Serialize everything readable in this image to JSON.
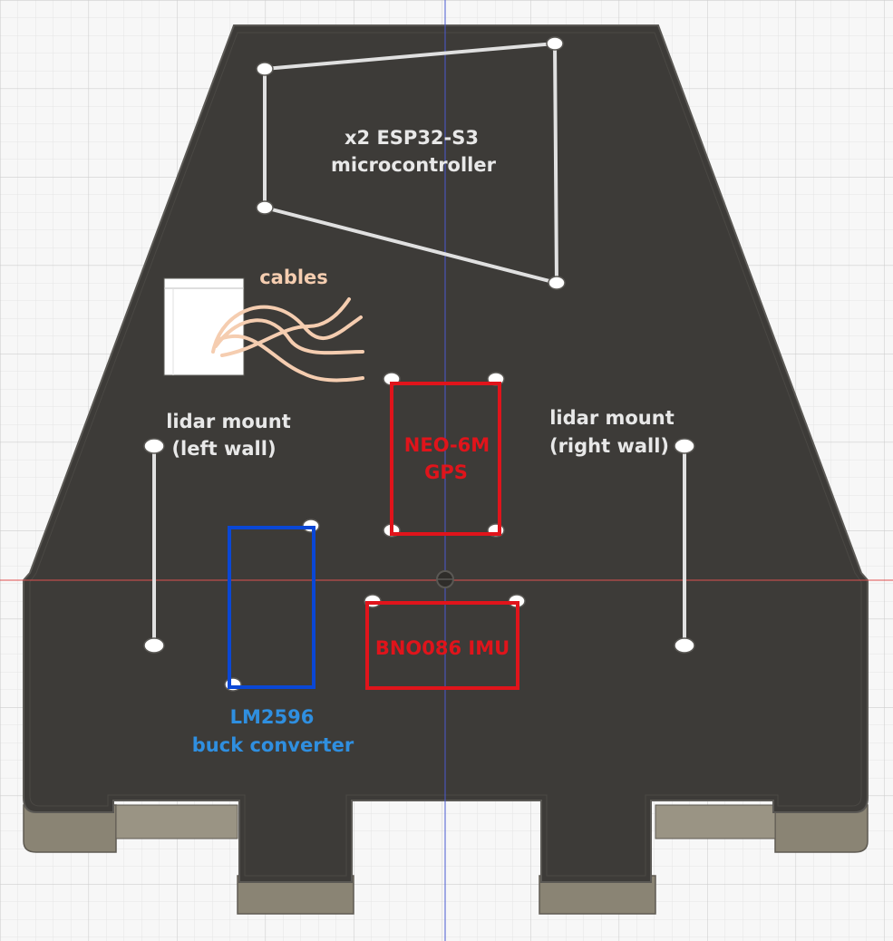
{
  "labels": {
    "esp32_line1": "x2 ESP32-S3",
    "esp32_line2": "microcontroller",
    "cables": "cables",
    "lidar_left_line1": "lidar mount",
    "lidar_left_line2": "(left wall)",
    "lidar_right_line1": "lidar mount",
    "lidar_right_line2": "(right wall)",
    "gps_line1": "NEO-6M",
    "gps_line2": "GPS",
    "imu": "BNO086 IMU",
    "buck_line1": "LM2596",
    "buck_line2": "buck converter"
  },
  "colors": {
    "grid_minor": "#e4e4e4",
    "grid_major": "#cfcfcf",
    "plate": "#3d3b38",
    "plate_edge": "#5a5854",
    "plate_side": "#8a8474",
    "outline_white": "#e0e0e0",
    "text_white": "#e8e8e8",
    "cables": "#f5cdb0",
    "red": "#e0141b",
    "blue": "#0a47d6",
    "buck_text": "#2f8fe0",
    "axis_red": "#e05050",
    "axis_blue": "#4a5ad0"
  }
}
